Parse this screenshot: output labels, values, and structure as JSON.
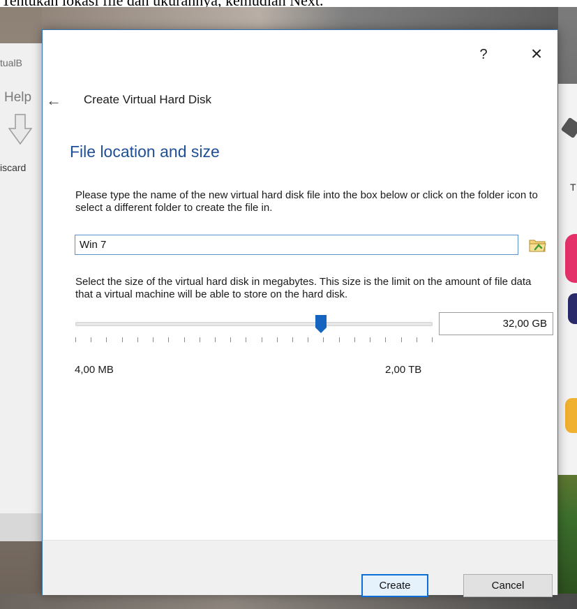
{
  "caption": {
    "text": "Tentukan lokasi file dan ukurannya, kemudian Next."
  },
  "background_app": {
    "title_fragment": "tualB",
    "menu_fragment": "Help",
    "toolbar_label_fragment": "iscard",
    "right_label_fragment": "T"
  },
  "dialog": {
    "help_label": "?",
    "close_label": "×",
    "back_label": "←",
    "header_title": "Create Virtual Hard Disk",
    "page_title": "File location and size",
    "location_description": "Please type the name of the new virtual hard disk file into the box below or click on the folder icon to select a different folder to create the file in.",
    "file_name_value": "Win 7",
    "size_description": "Select the size of the virtual hard disk in megabytes. This size is the limit on the amount of file data that a virtual machine will be able to store on the hard disk.",
    "size_value": "32,00 GB",
    "slider_min_label": "4,00 MB",
    "slider_max_label": "2,00 TB",
    "slider_position_fraction": 0.688,
    "slider_tick_count": 24,
    "create_label": "Create",
    "cancel_label": "Cancel"
  },
  "icons": {
    "back": "arrow-left-icon",
    "folder": "folder-icon",
    "help": "question-icon",
    "close": "close-icon"
  },
  "colors": {
    "accent": "#0a6fd6",
    "title_blue": "#1e4f96",
    "slider_handle": "#1565c0"
  }
}
